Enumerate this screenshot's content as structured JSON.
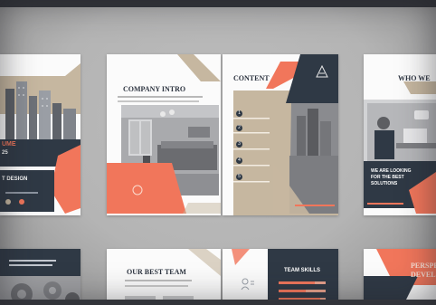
{
  "colors": {
    "coral": "#f1765b",
    "navy": "#2f3945",
    "taupe": "#c6b7a0",
    "paper": "#fbfbfb",
    "background": "#b5b5b5"
  },
  "pages": {
    "company_intro": {
      "title": "COMPANY INTRO"
    },
    "content": {
      "title": "CONTENT",
      "numbers": [
        "1",
        "2",
        "3",
        "4",
        "5"
      ]
    },
    "who_we": {
      "title": "WHO WE",
      "callout": [
        "WE ARE LOOKING",
        "FOR THE BEST",
        "SOLUTIONS"
      ]
    },
    "city_cover": {
      "partial_lines": [
        "UME",
        "25",
        "T DESIGN"
      ]
    },
    "best_team": {
      "title": "OUR BEST TEAM"
    },
    "team_skills": {
      "title": "TEAM SKILLS"
    },
    "persp": {
      "partial_lines": [
        "PERSPE",
        "DEVEL"
      ]
    }
  },
  "icons": [
    "logo-a-icon",
    "user-profile-icon"
  ]
}
